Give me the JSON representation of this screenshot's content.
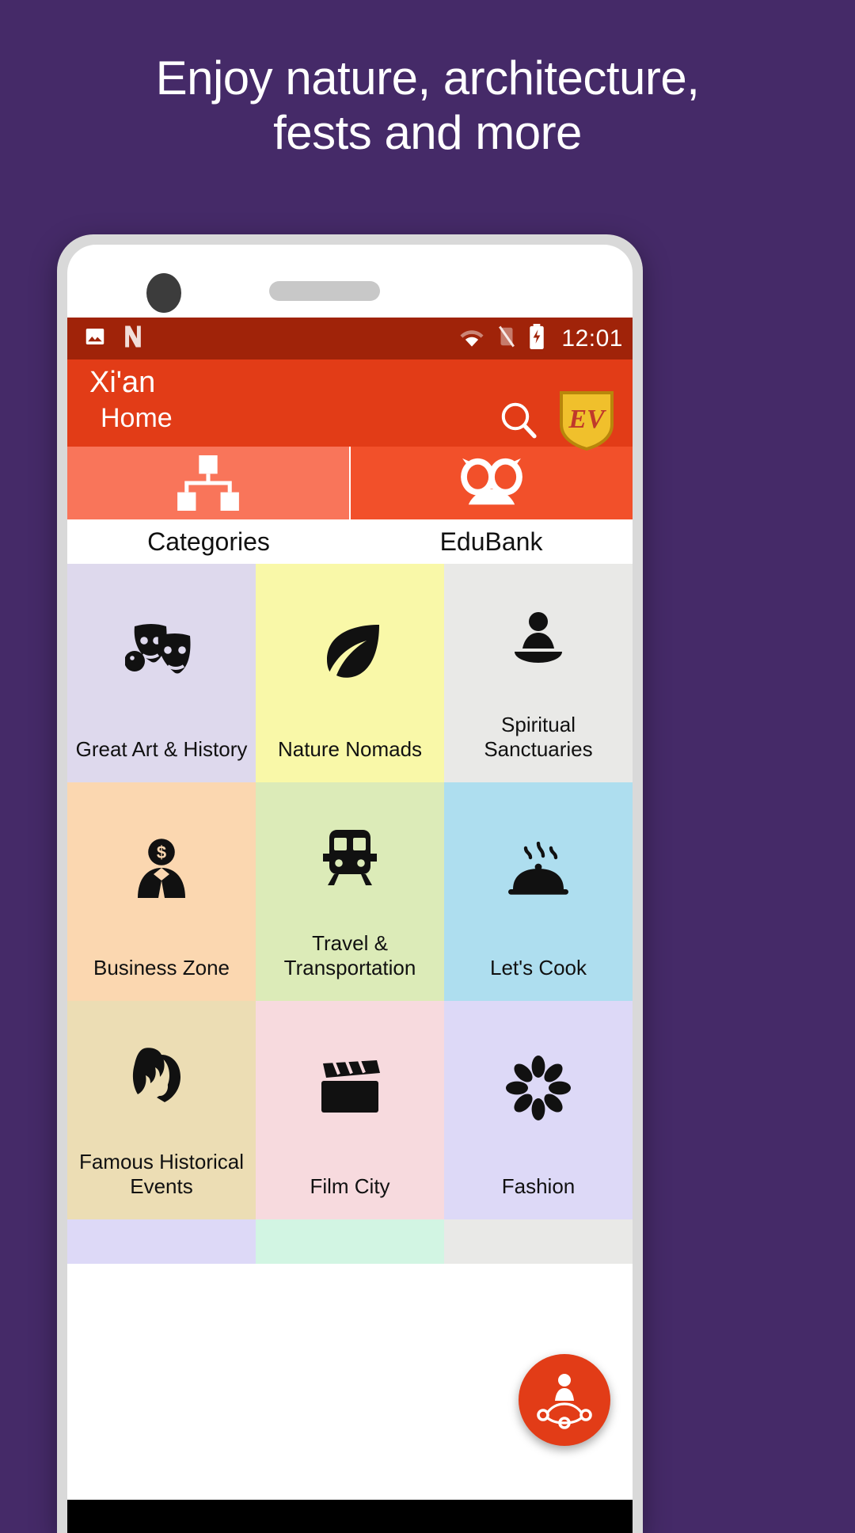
{
  "promo": {
    "headline_line1": "Enjoy nature, architecture,",
    "headline_line2": "fests and more",
    "background_color": "#452a68",
    "text_color": "#ffffff"
  },
  "phone": {
    "camera": "front-camera",
    "speaker": "earpiece-speaker"
  },
  "statusbar": {
    "background_color": "#a02309",
    "clock": "12:01",
    "icons": [
      "photo-icon",
      "nova-launcher-icon",
      "wifi-icon",
      "signal-off-icon",
      "battery-charging-icon"
    ]
  },
  "appbar": {
    "background_color": "#e23c17",
    "city": "Xi'an",
    "section": "Home",
    "search_icon": "search-icon",
    "logo_text": "EV",
    "logo_name": "ev-shield-logo"
  },
  "tabs": [
    {
      "label": "Categories",
      "icon": "sitemap-icon",
      "active": true,
      "color": "#f9755a"
    },
    {
      "label": "EduBank",
      "icon": "owl-icon",
      "active": false,
      "color": "#f2502a"
    }
  ],
  "grid": {
    "tiles": [
      {
        "label": "Great Art & History",
        "icon": "theater-masks-icon",
        "color": "#ded9ed"
      },
      {
        "label": "Nature Nomads",
        "icon": "leaf-icon",
        "color": "#f9f8a8"
      },
      {
        "label": "Spiritual Sanctuaries",
        "icon": "buddha-icon",
        "color": "#e9e9e7"
      },
      {
        "label": "Business Zone",
        "icon": "businessman-icon",
        "color": "#fbd7b0"
      },
      {
        "label": "Travel &\nTransportation",
        "icon": "train-icon",
        "color": "#dcebb8"
      },
      {
        "label": "Let's Cook",
        "icon": "cloche-icon",
        "color": "#aede ef"
      },
      {
        "label": "Famous Historical\nEvents",
        "icon": "spartan-helmet-icon",
        "color": "#ecddb4"
      },
      {
        "label": "Film City",
        "icon": "clapperboard-icon",
        "color": "#f7dade"
      },
      {
        "label": "Fashion",
        "icon": "flower-icon",
        "color": "#ddd9f7"
      },
      {
        "label": "",
        "icon": "",
        "color": "#ddd9f7"
      },
      {
        "label": "",
        "icon": "",
        "color": "#d2f5e3"
      },
      {
        "label": "",
        "icon": "",
        "color": "#e9e9e7"
      }
    ]
  },
  "fab": {
    "icon": "people-network-icon",
    "color": "#e23c17"
  }
}
